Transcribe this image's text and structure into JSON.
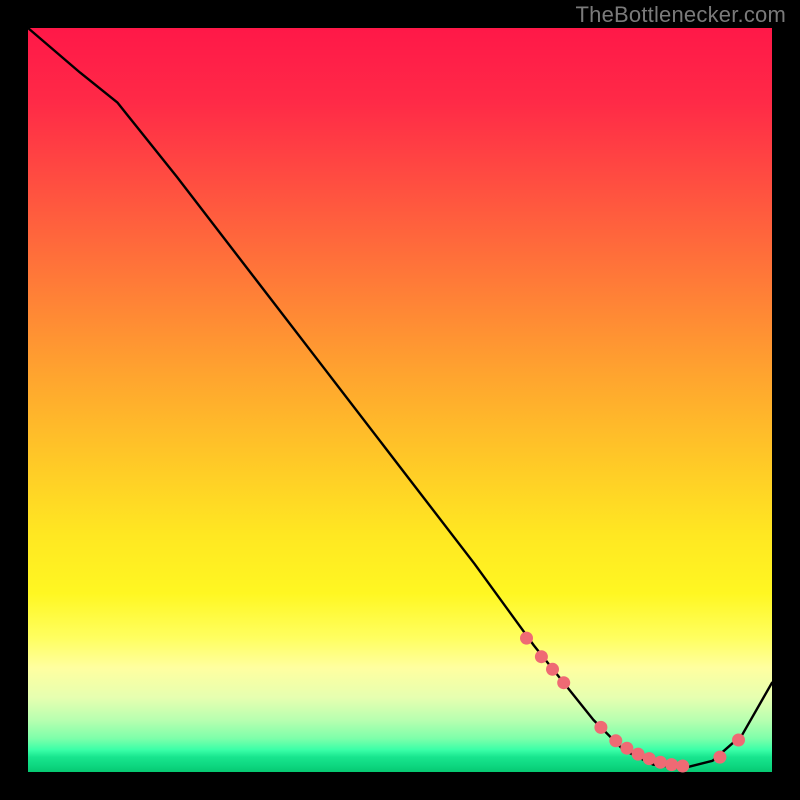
{
  "watermark": "TheBottlenecker.com",
  "chart_data": {
    "type": "line",
    "title": "",
    "xlabel": "",
    "ylabel": "",
    "xlim": [
      0,
      100
    ],
    "ylim": [
      0,
      100
    ],
    "series": [
      {
        "name": "curve",
        "x": [
          0,
          7,
          12,
          20,
          30,
          40,
          50,
          60,
          68,
          72,
          76,
          80,
          84,
          88,
          92,
          96,
          100
        ],
        "y": [
          100,
          94,
          90,
          80,
          67,
          54,
          41,
          28,
          17,
          12,
          7,
          3,
          1,
          0.5,
          1.5,
          5,
          12
        ]
      }
    ],
    "markers": {
      "name": "highlight-dots",
      "color": "#ef6a74",
      "points_x": [
        67,
        69,
        70.5,
        72,
        77,
        79,
        80.5,
        82,
        83.5,
        85,
        86.5,
        88,
        93,
        95.5
      ],
      "points_y": [
        18,
        15.5,
        13.8,
        12,
        6,
        4.2,
        3.2,
        2.4,
        1.8,
        1.3,
        1,
        0.8,
        2,
        4.3
      ]
    }
  }
}
